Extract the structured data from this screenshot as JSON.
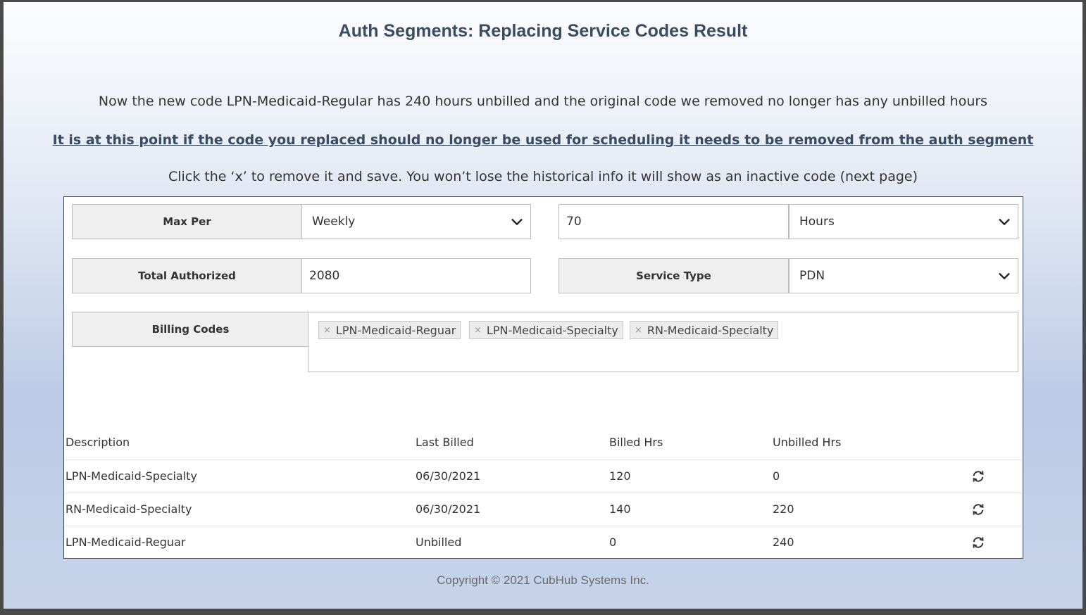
{
  "slide": {
    "title": "Auth Segments: Replacing Service Codes Result",
    "line1": "Now the new code LPN-Medicaid-Regular has 240 hours unbilled and the original code we removed no longer has any unbilled hours",
    "line2": "It is at this point if the code you replaced should no longer be used for scheduling it needs to be removed from the auth segment",
    "line3": "Click the ‘x’ to remove it and save. You won’t lose the historical info it will show as an inactive code (next page)",
    "footer": "Copyright © 2021 CubHub Systems Inc."
  },
  "form": {
    "max_per_label": "Max Per",
    "max_per_value": "Weekly",
    "amount_value": "70",
    "unit_value": "Hours",
    "total_authorized_label": "Total Authorized",
    "total_authorized_value": "2080",
    "service_type_label": "Service Type",
    "service_type_value": "PDN",
    "billing_codes_label": "Billing Codes",
    "billing_codes": [
      {
        "remove": "×",
        "label": "LPN-Medicaid-Reguar"
      },
      {
        "remove": "×",
        "label": "LPN-Medicaid-Specialty"
      },
      {
        "remove": "×",
        "label": "RN-Medicaid-Specialty"
      }
    ]
  },
  "table": {
    "headers": [
      "Description",
      "Last Billed",
      "Billed Hrs",
      "Unbilled Hrs"
    ],
    "rows": [
      {
        "description": "LPN-Medicaid-Specialty",
        "last_billed": "06/30/2021",
        "billed_hrs": "120",
        "unbilled_hrs": "0",
        "action_icon": "refresh-icon"
      },
      {
        "description": "RN-Medicaid-Specialty",
        "last_billed": "06/30/2021",
        "billed_hrs": "140",
        "unbilled_hrs": "220",
        "action_icon": "refresh-icon"
      },
      {
        "description": "LPN-Medicaid-Reguar",
        "last_billed": "Unbilled",
        "billed_hrs": "0",
        "unbilled_hrs": "240",
        "action_icon": "refresh-icon"
      }
    ]
  },
  "colors": {
    "title": "#3a4b63",
    "panel_border": "#3b4a5e",
    "label_bg": "#efefef",
    "tag_bg": "#ececec"
  }
}
